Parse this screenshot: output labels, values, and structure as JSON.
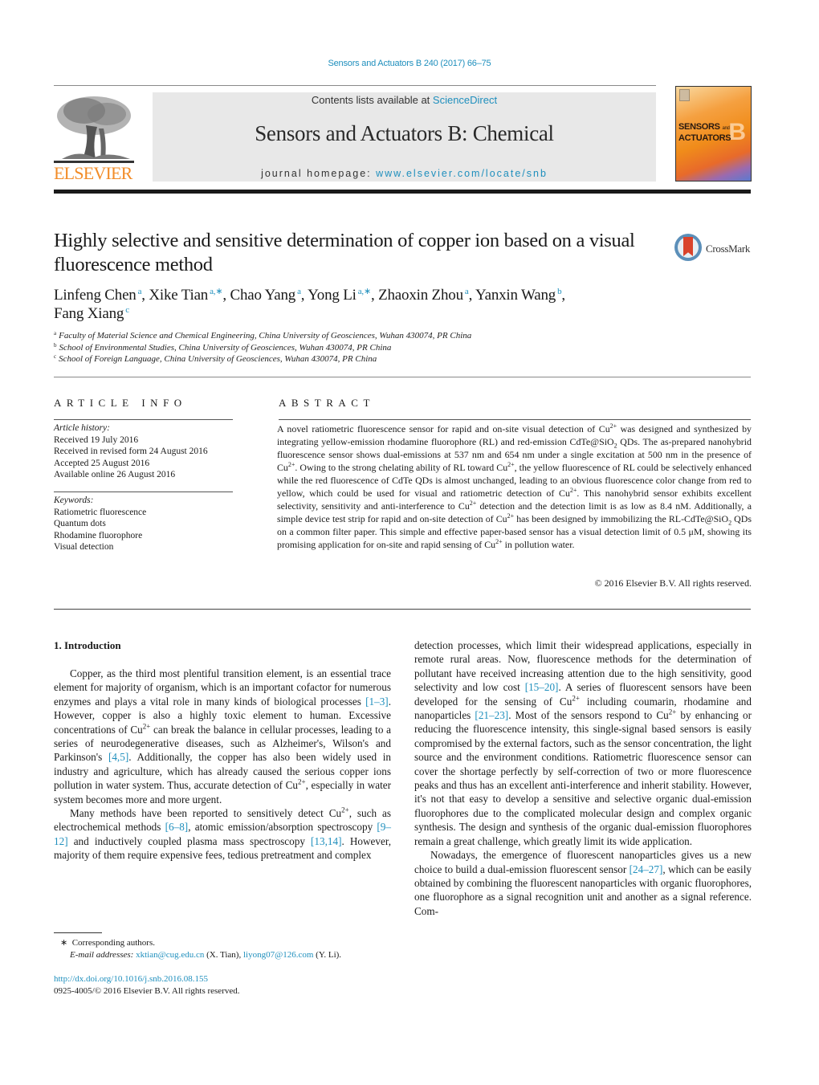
{
  "header": {
    "journal_ref": "Sensors and Actuators B 240 (2017) 66–75",
    "publisher_logo_text": "ELSEVIER",
    "contents_prefix": "Contents lists available at ",
    "contents_link": "ScienceDirect",
    "journal_title": "Sensors and Actuators B: Chemical",
    "homepage_prefix": "journal homepage: ",
    "homepage_link": "www.elsevier.com/locate/snb",
    "cover_title_line1": "SENSORS",
    "cover_title_and": "and",
    "cover_title_line2": "ACTUATORS",
    "cover_letter": "B"
  },
  "article": {
    "title": "Highly selective and sensitive determination of copper ion based on a visual fluorescence method",
    "crossmark_label": "CrossMark",
    "authors": [
      {
        "name": "Linfeng Chen",
        "aff": "a",
        "sep": ", "
      },
      {
        "name": "Xike Tian",
        "aff": "a,∗",
        "sep": ", "
      },
      {
        "name": "Chao Yang",
        "aff": "a",
        "sep": ", "
      },
      {
        "name": "Yong Li",
        "aff": "a,∗",
        "sep": ", "
      },
      {
        "name": "Zhaoxin Zhou",
        "aff": "a",
        "sep": ", "
      },
      {
        "name": "Yanxin Wang",
        "aff": "b",
        "sep": ","
      },
      {
        "name": "Fang Xiang",
        "aff": "c",
        "sep": ""
      }
    ],
    "affiliations": [
      {
        "key": "a",
        "text": "Faculty of Material Science and Chemical Engineering, China University of Geosciences, Wuhan 430074, PR China"
      },
      {
        "key": "b",
        "text": "School of Environmental Studies, China University of Geosciences, Wuhan 430074, PR China"
      },
      {
        "key": "c",
        "text": "School of Foreign Language, China University of Geosciences, Wuhan 430074, PR China"
      }
    ]
  },
  "article_info": {
    "heading": "ARTICLE INFO",
    "history_label": "Article history:",
    "history": [
      "Received 19 July 2016",
      "Received in revised form 24 August 2016",
      "Accepted 25 August 2016",
      "Available online 26 August 2016"
    ],
    "keywords_label": "Keywords:",
    "keywords": [
      "Ratiometric fluorescence",
      "Quantum dots",
      "Rhodamine fluorophore",
      "Visual detection"
    ]
  },
  "abstract": {
    "heading": "ABSTRACT",
    "parts": [
      "A novel ratiometric fluorescence sensor for rapid and on-site visual detection of Cu",
      " was designed and synthesized by integrating yellow-emission rhodamine fluorophore (RL) and red-emission CdTe@SiO",
      " QDs. The as-prepared nanohybrid fluorescence sensor shows dual-emissions at 537 nm and 654 nm under a single excitation at 500 nm in the presence of Cu",
      ". Owing to the strong chelating ability of RL toward Cu",
      ", the yellow fluorescence of RL could be selectively enhanced while the red fluorescence of CdTe QDs is almost unchanged, leading to an obvious fluorescence color change from red to yellow, which could be used for visual and ratiometric detection of Cu",
      ". This nanohybrid sensor exhibits excellent selectivity, sensitivity and anti-interference to Cu",
      " detection and the detection limit is as low as 8.4 nM. Additionally, a simple device test strip for rapid and on-site detection of Cu",
      " has been designed by immobilizing the RL-CdTe@SiO",
      " QDs on a common filter paper. This simple and effective paper-based sensor has a visual detection limit of 0.5 μM, showing its promising application for on-site and rapid sensing of Cu",
      " in pollution water."
    ],
    "sup_charge": "2+",
    "sub_two": "2",
    "copyright": "© 2016 Elsevier B.V. All rights reserved."
  },
  "body": {
    "section_heading": "1.  Introduction",
    "cu": "Cu",
    "charge": "2+",
    "p1": [
      "Copper, as the third most plentiful transition element, is an essential trace element for majority of organism, which is an important cofactor for numerous enzymes and plays a vital role in many kinds of biological processes ",
      "[1–3]",
      ". However, copper is also a highly toxic element to human. Excessive concentrations of ",
      " can break the balance in cellular processes, leading to a series of neurodegenerative diseases, such as Alzheimer's, Wilson's and Parkinson's ",
      "[4,5]",
      ". Additionally, the copper has also been widely used in industry and agriculture, which has already caused the serious copper ions pollution in water system. Thus, accurate detection of ",
      ", especially in water system becomes more and more urgent."
    ],
    "p2": [
      "Many methods have been reported to sensitively detect ",
      ", such as electrochemical methods ",
      "[6–8]",
      ", atomic emission/absorption spectroscopy ",
      "[9–12]",
      " and inductively coupled plasma mass spectroscopy ",
      "[13,14]",
      ". However, majority of them require expensive fees, tedious pretreatment and complex"
    ],
    "p3": [
      "detection processes, which limit their widespread applications, especially in remote rural areas. Now, fluorescence methods for the determination of pollutant have received increasing attention due to the high sensitivity, good selectivity and low cost ",
      "[15–20]",
      ". A series of fluorescent sensors have been developed for the sensing of ",
      " including coumarin, rhodamine and nanoparticles ",
      "[21–23]",
      ". Most of the sensors respond to ",
      " by enhancing or reducing the fluorescence intensity, this single-signal based sensors is easily compromised by the external factors, such as the sensor concentration, the light source and the environment conditions. Ratiometric fluorescence sensor can cover the shortage perfectly by self-correction of two or more fluorescence peaks and thus has an excellent anti-interference and inherit stability. However, it's not that easy to develop a sensitive and selective organic dual-emission fluorophores due to the complicated molecular design and complex organic synthesis. The design and synthesis of the organic dual-emission fluorophores remain a great challenge, which greatly limit its wide application."
    ],
    "p4": [
      "Nowadays, the emergence of fluorescent nanoparticles gives us a new choice to build a dual-emission fluorescent sensor ",
      "[24–27]",
      ", which can be easily obtained by combining the fluorescent nanoparticles with organic fluorophores, one fluorophore as a signal recognition unit and another as a signal reference. Com-"
    ]
  },
  "footnotes": {
    "star": "∗",
    "corresponding": "Corresponding authors.",
    "email_label": "E-mail addresses:",
    "email1": "xktian@cug.edu.cn",
    "email1_who": " (X. Tian), ",
    "email2": "liyong07@126.com",
    "email2_who": " (Y. Li).",
    "doi": "http://dx.doi.org/10.1016/j.snb.2016.08.155",
    "issn_line": "0925-4005/© 2016 Elsevier B.V. All rights reserved."
  },
  "colors": {
    "link": "#1f8fbd",
    "elsevier_orange": "#f28c28",
    "header_box": "#e8e8e8"
  }
}
